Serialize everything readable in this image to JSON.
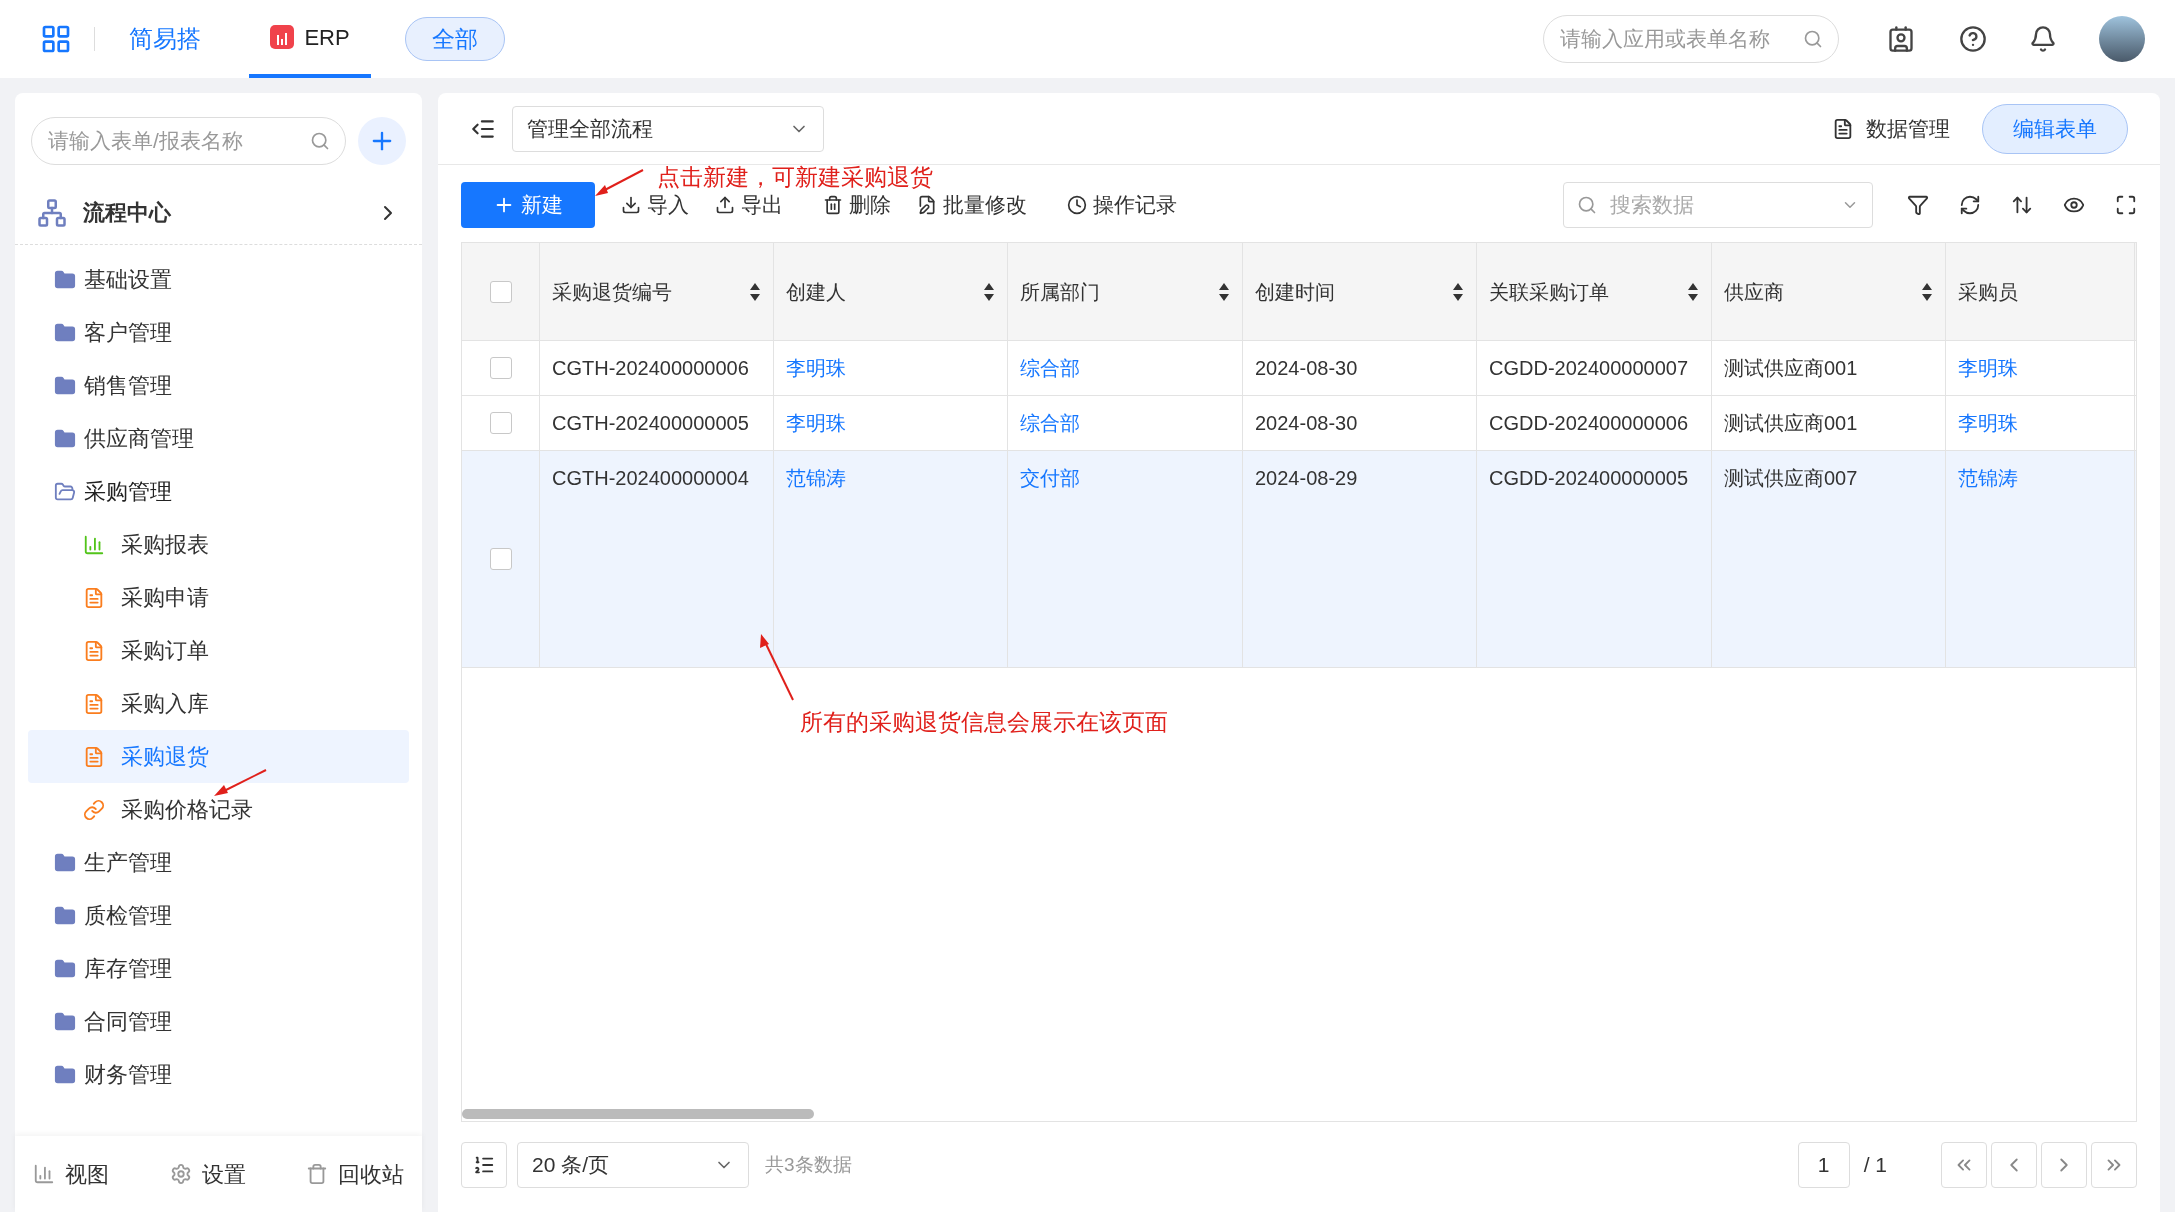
{
  "topbar": {
    "app_name": "简易搭",
    "tabs": [
      {
        "label": "ERP",
        "selected": true
      }
    ],
    "scope_button": "全部",
    "search": {
      "placeholder": "请输入应用或表单名称"
    }
  },
  "sidebar": {
    "search": {
      "placeholder": "请输入表单/报表名称"
    },
    "section": "流程中心",
    "items": [
      {
        "kind": "folder",
        "label": "基础设置",
        "selected": false
      },
      {
        "kind": "folder",
        "label": "客户管理",
        "selected": false
      },
      {
        "kind": "folder",
        "label": "销售管理",
        "selected": false
      },
      {
        "kind": "folder",
        "label": "供应商管理",
        "selected": false
      },
      {
        "kind": "folder",
        "label": "采购管理",
        "selected": false,
        "expanded": true,
        "children": [
          {
            "kind": "chart",
            "label": "采购报表",
            "selected": false
          },
          {
            "kind": "form",
            "label": "采购申请",
            "selected": false
          },
          {
            "kind": "form",
            "label": "采购订单",
            "selected": false
          },
          {
            "kind": "form",
            "label": "采购入库",
            "selected": false
          },
          {
            "kind": "form",
            "label": "采购退货",
            "selected": true
          },
          {
            "kind": "link",
            "label": "采购价格记录",
            "selected": false
          }
        ]
      },
      {
        "kind": "folder",
        "label": "生产管理",
        "selected": false
      },
      {
        "kind": "folder",
        "label": "质检管理",
        "selected": false
      },
      {
        "kind": "folder",
        "label": "库存管理",
        "selected": false
      },
      {
        "kind": "folder",
        "label": "合同管理",
        "selected": false
      },
      {
        "kind": "folder",
        "label": "财务管理",
        "selected": false
      }
    ],
    "footer": [
      {
        "kind": "view",
        "label": "视图"
      },
      {
        "kind": "settings",
        "label": "设置"
      },
      {
        "kind": "trash",
        "label": "回收站"
      }
    ]
  },
  "main": {
    "view_select": "管理全部流程",
    "data_manage": "数据管理",
    "edit_form": "编辑表单",
    "new_button": "新建",
    "actions": [
      {
        "kind": "import",
        "label": "导入"
      },
      {
        "kind": "export",
        "label": "导出"
      },
      {
        "kind": "delete",
        "label": "删除"
      },
      {
        "kind": "batch",
        "label": "批量修改"
      },
      {
        "kind": "log",
        "label": "操作记录"
      }
    ],
    "search": {
      "placeholder": "搜索数据"
    }
  },
  "table": {
    "header_checked": false,
    "columns": [
      {
        "label": "采购退货编号",
        "kind": "text"
      },
      {
        "label": "创建人",
        "kind": "link"
      },
      {
        "label": "所属部门",
        "kind": "link"
      },
      {
        "label": "创建时间",
        "kind": "text"
      },
      {
        "label": "关联采购订单",
        "kind": "text"
      },
      {
        "label": "供应商",
        "kind": "text"
      },
      {
        "label": "采购员",
        "kind": "link"
      }
    ],
    "rows": [
      {
        "checked": false,
        "highlighted": false,
        "cells": [
          "CGTH-202400000006",
          "李明珠",
          "综合部",
          "2024-08-30",
          "CGDD-202400000007",
          "测试供应商001",
          "李明珠"
        ]
      },
      {
        "checked": false,
        "highlighted": false,
        "cells": [
          "CGTH-202400000005",
          "李明珠",
          "综合部",
          "2024-08-30",
          "CGDD-202400000006",
          "测试供应商001",
          "李明珠"
        ]
      },
      {
        "checked": false,
        "highlighted": true,
        "cells": [
          "CGTH-202400000004",
          "范锦涛",
          "交付部",
          "2024-08-29",
          "CGDD-202400000005",
          "测试供应商007",
          "范锦涛"
        ]
      }
    ]
  },
  "pagination": {
    "page_size": "20 条/页",
    "total": "共3条数据",
    "page": "1",
    "pages": "/ 1"
  },
  "annotations": [
    {
      "text": "点击新建，可新建采购退货"
    },
    {
      "text": "所有的采购退货信息会展示在该页面"
    }
  ]
}
